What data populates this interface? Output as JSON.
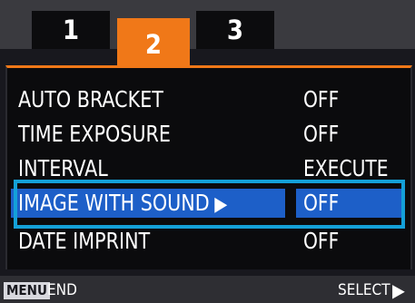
{
  "tabs": [
    {
      "label": "1",
      "active": false
    },
    {
      "label": "2",
      "active": true
    },
    {
      "label": "3",
      "active": false
    }
  ],
  "menu": {
    "items": [
      {
        "label": "AUTO BRACKET",
        "value": "OFF",
        "selected": false
      },
      {
        "label": "TIME EXPOSURE",
        "value": "OFF",
        "selected": false
      },
      {
        "label": "INTERVAL",
        "value": "EXECUTE",
        "selected": false
      },
      {
        "label": "IMAGE WITH SOUND",
        "value": "OFF",
        "selected": true
      },
      {
        "label": "DATE IMPRINT",
        "value": "OFF",
        "selected": false
      }
    ]
  },
  "footer": {
    "menu_key": "MENU",
    "end_label": "END",
    "select_label": "SELECT",
    "select_arrow": "▶"
  },
  "colors": {
    "active_tab": "#f07818",
    "selection": "#1d5fc8",
    "highlight_frame": "#14a0d8",
    "background": "#0b0b0d"
  },
  "icons": {
    "selected_arrow": "▶"
  }
}
